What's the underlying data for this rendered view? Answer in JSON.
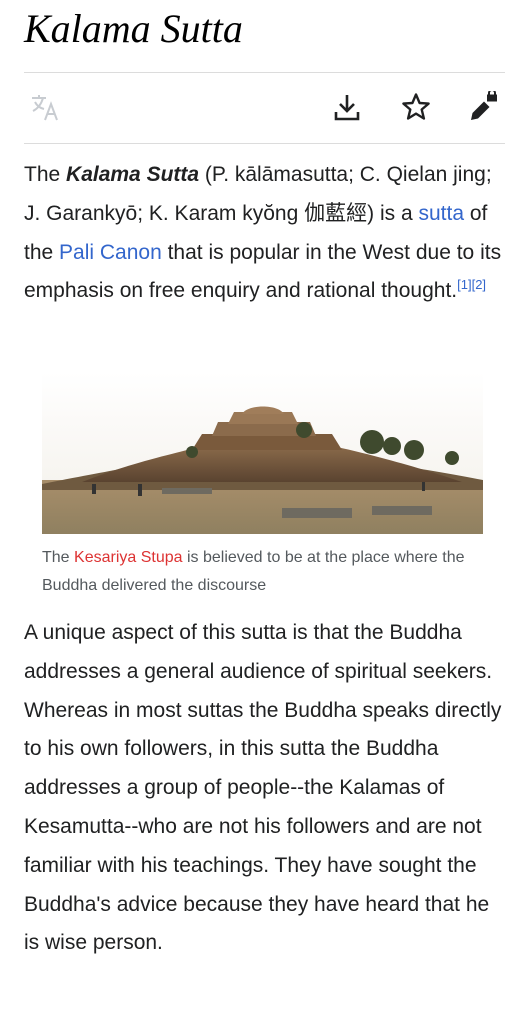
{
  "page": {
    "title": "Kalama Sutta"
  },
  "toolbar": {
    "language_icon": "translate-icon",
    "download_icon": "download-icon",
    "watch_icon": "star-icon",
    "edit_icon": "pencil-lock-icon"
  },
  "lead": {
    "t1": "The ",
    "bold_title": "Kalama Sutta",
    "t2": " (P. kālāmasutta; C. Qielan jing; J. Garankyō; K. Karam kyŏng 伽藍經) is a ",
    "link_sutta": "sutta",
    "t3": " of the ",
    "link_pali": "Pali Canon",
    "t4": " that is popular in the West due to its emphasis on free enquiry and rational thought.",
    "refs": "[1][2]"
  },
  "figure": {
    "caption_t1": "The ",
    "caption_link": "Kesariya Stupa",
    "caption_t2": " is believed to be at the place where the Buddha delivered the discourse"
  },
  "body": {
    "paragraph": "A unique aspect of this sutta is that the Buddha addresses a general audience of spiritual seekers. Whereas in most suttas the Buddha speaks directly to his own followers, in this sutta the Buddha addresses a group of people--the Kalamas of Kesamutta--who are not his followers and are not familiar with his teachings. They have sought the Buddha's advice because they have heard that he is wise person."
  },
  "colors": {
    "link": "#3366cc",
    "redlink": "#dd3333",
    "text": "#202122",
    "caption": "#54595d"
  }
}
